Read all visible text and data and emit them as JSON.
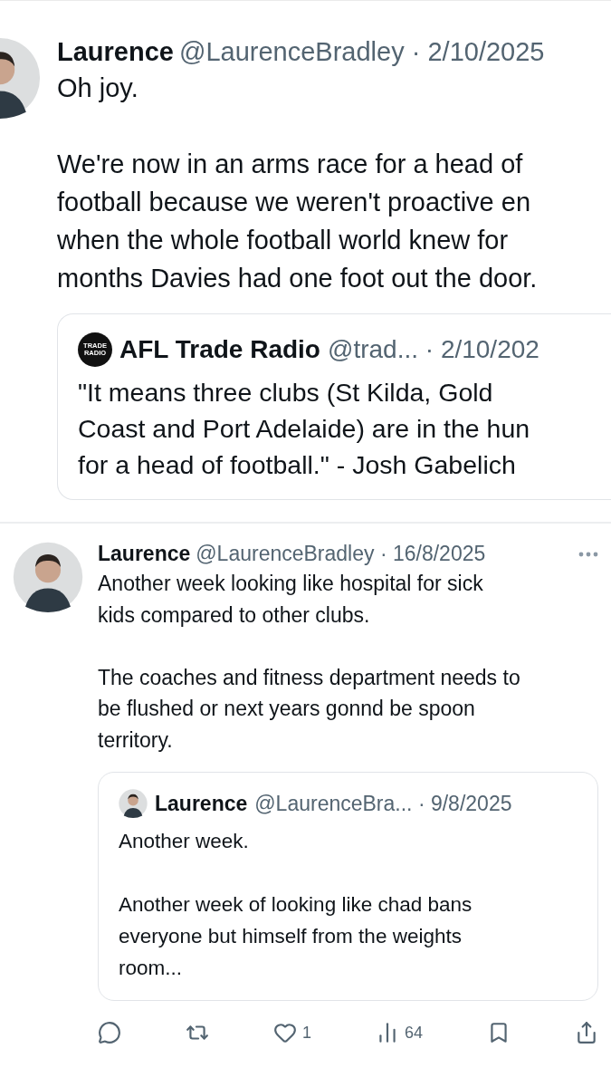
{
  "posts": [
    {
      "kind": "enlarged",
      "name": "Laurence",
      "handle": "@LaurenceBradley",
      "separator": "·",
      "date": "2/10/2025",
      "body": "Oh joy.\n\nWe're now in an arms race for a head of\nfootball because we weren't proactive en\nwhen the whole football world knew for\nmonths Davies had one foot out the door.",
      "quote": {
        "logo_text": "TRADE RADIO",
        "name": "AFL Trade Radio",
        "handle": "@trad...",
        "separator": "·",
        "date": "2/10/202",
        "body": "\"It means three clubs (St Kilda, Gold\nCoast and Port Adelaide) are in the hun\nfor a head of football.\" - Josh Gabelich"
      }
    },
    {
      "kind": "normal",
      "name": "Laurence",
      "handle": "@LaurenceBradley",
      "separator": "·",
      "date": "16/8/2025",
      "more": true,
      "body": "Another week looking like hospital for sick\nkids compared to other clubs.\n\nThe coaches and fitness department needs to\nbe flushed or next years gonnd be spoon\nterritory.",
      "quote": {
        "name": "Laurence",
        "handle": "@LaurenceBra...",
        "separator": "·",
        "date": "9/8/2025",
        "body": "Another week.\n\nAnother week of looking like chad bans\neveryone but himself from the weights\nroom..."
      },
      "actions": [
        {
          "kind": "reply"
        },
        {
          "kind": "repost"
        },
        {
          "kind": "like",
          "count": "1"
        },
        {
          "kind": "views",
          "count": "64"
        },
        {
          "kind": "bookmark"
        },
        {
          "kind": "share"
        }
      ]
    }
  ]
}
